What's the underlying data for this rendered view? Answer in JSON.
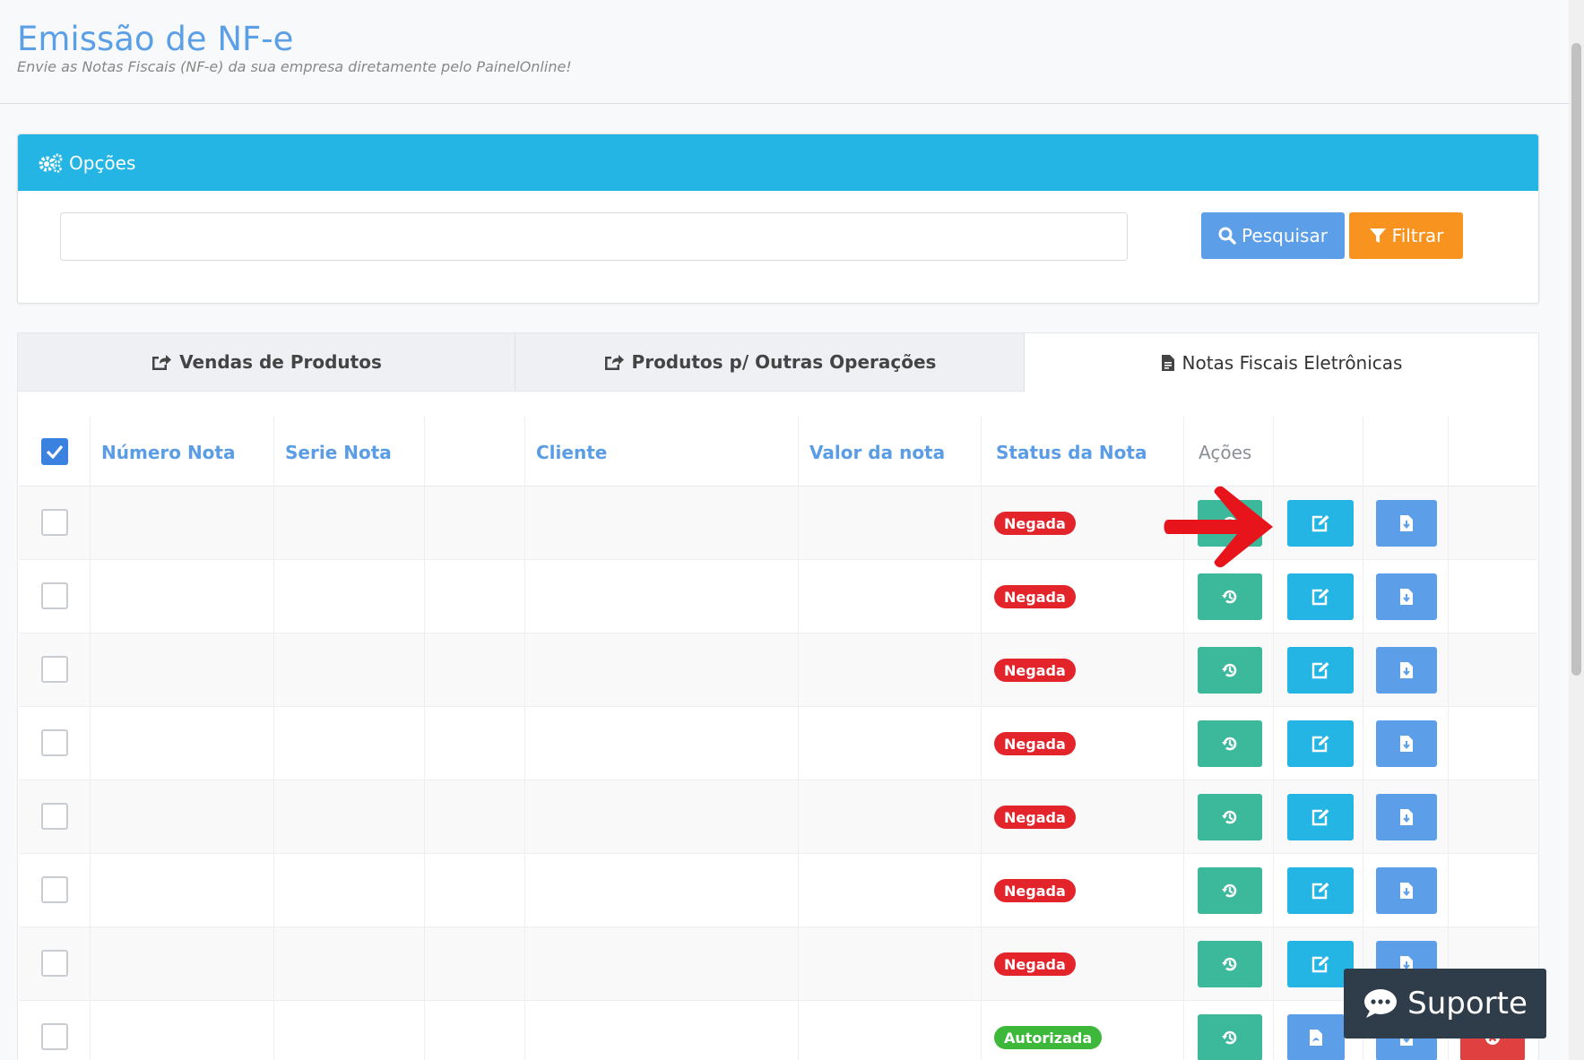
{
  "header": {
    "title": "Emissão de NF-e",
    "subtitle": "Envie as Notas Fiscais (NF-e) da sua empresa diretamente pelo PainelOnline!"
  },
  "options": {
    "title": "Opções",
    "search_value": "",
    "search_label": "Pesquisar",
    "filter_label": "Filtrar",
    "accent_color": "#24b5e5"
  },
  "tabs": [
    {
      "label": "Vendas de Produtos",
      "icon": "share-square-icon",
      "active": false
    },
    {
      "label": "Produtos p/ Outras Operações",
      "icon": "share-square-icon",
      "active": false
    },
    {
      "label": "Notas Fiscais Eletrônicas",
      "icon": "file-invoice-icon",
      "active": true
    }
  ],
  "table": {
    "columns": [
      "Número Nota",
      "Serie Nota",
      "",
      "Cliente",
      "Valor da nota",
      "Status da Nota",
      "Ações"
    ],
    "select_all_checked": true,
    "rows": [
      {
        "status": "Negada",
        "status_color": "#e3242b",
        "actions": [
          "history-icon",
          "edit-icon",
          "file-download-icon"
        ]
      },
      {
        "status": "Negada",
        "status_color": "#e3242b",
        "actions": [
          "history-icon",
          "edit-icon",
          "file-download-icon"
        ]
      },
      {
        "status": "Negada",
        "status_color": "#e3242b",
        "actions": [
          "history-icon",
          "edit-icon",
          "file-download-icon"
        ]
      },
      {
        "status": "Negada",
        "status_color": "#e3242b",
        "actions": [
          "history-icon",
          "edit-icon",
          "file-download-icon"
        ]
      },
      {
        "status": "Negada",
        "status_color": "#e3242b",
        "actions": [
          "history-icon",
          "edit-icon",
          "file-download-icon"
        ]
      },
      {
        "status": "Negada",
        "status_color": "#e3242b",
        "actions": [
          "history-icon",
          "edit-icon",
          "file-download-icon"
        ]
      },
      {
        "status": "Negada",
        "status_color": "#e3242b",
        "actions": [
          "history-icon",
          "edit-icon",
          "file-download-icon"
        ]
      },
      {
        "status": "Autorizada",
        "status_color": "#3db83a",
        "actions": [
          "history-icon",
          "file-pdf-icon",
          "file-download-icon",
          "cancel-icon"
        ]
      }
    ]
  },
  "support": {
    "label": "Suporte"
  },
  "annotation": {
    "arrow_color": "#e8141b"
  }
}
